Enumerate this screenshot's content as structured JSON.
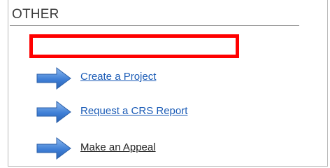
{
  "section": {
    "title": "OTHER"
  },
  "links": [
    {
      "label": "Create a Project",
      "icon": "right-arrow-icon",
      "color": "#1a5bb6"
    },
    {
      "label": "Request a CRS Report",
      "icon": "right-arrow-icon",
      "color": "#1a5bb6"
    },
    {
      "label": "Make an Appeal",
      "icon": "right-arrow-icon",
      "color": "#222222"
    }
  ],
  "colors": {
    "highlight_border": "#ff0000",
    "arrow_fill": "#3f7fd6",
    "arrow_light": "#8fbaf0"
  }
}
